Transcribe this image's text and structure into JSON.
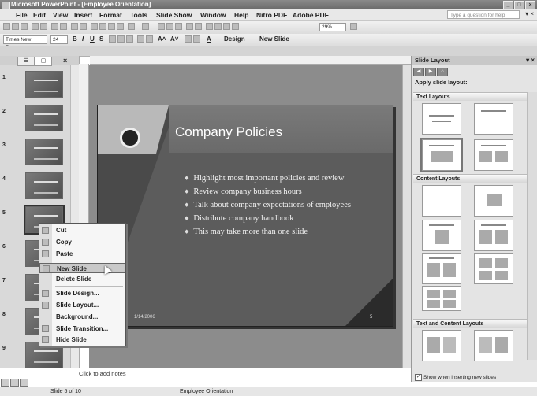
{
  "window": {
    "title": "Microsoft PowerPoint - [Employee Orientation]"
  },
  "menubar": {
    "items": [
      "File",
      "Edit",
      "View",
      "Insert",
      "Format",
      "Tools",
      "Slide Show",
      "Window",
      "Help",
      "Nitro PDF",
      "Adobe PDF"
    ],
    "help_placeholder": "Type a question for help"
  },
  "toolbar": {
    "zoom": "29%",
    "font": "Times New Roman",
    "font_size": "24",
    "design_label": "Design",
    "new_slide_label": "New Slide"
  },
  "slides_pane": {
    "numbers": [
      "1",
      "2",
      "3",
      "4",
      "5",
      "6",
      "7",
      "8",
      "9"
    ],
    "selected_index": 4
  },
  "slide": {
    "title": "Company Policies",
    "bullets": [
      "Highlight most important policies and review",
      "Review company business hours",
      "Talk about company expectations of employees",
      "Distribute company handbook",
      "This may take more than one slide"
    ],
    "date": "1/14/2006",
    "number": "5"
  },
  "notes": {
    "placeholder": "Click to add notes"
  },
  "context_menu": {
    "items": [
      "Cut",
      "Copy",
      "Paste",
      "New Slide",
      "Delete Slide",
      "Slide Design...",
      "Slide Layout...",
      "Background...",
      "Slide Transition...",
      "Hide Slide"
    ],
    "highlighted": "New Slide"
  },
  "task_pane": {
    "title": "Slide Layout",
    "apply_label": "Apply slide layout:",
    "sections": [
      "Text Layouts",
      "Content Layouts",
      "Text and Content Layouts"
    ],
    "checkbox_label": "Show when inserting new slides",
    "checkbox_checked": true
  },
  "status": {
    "slide_count": "Slide 5 of 10",
    "template": "Employee Orientation"
  }
}
